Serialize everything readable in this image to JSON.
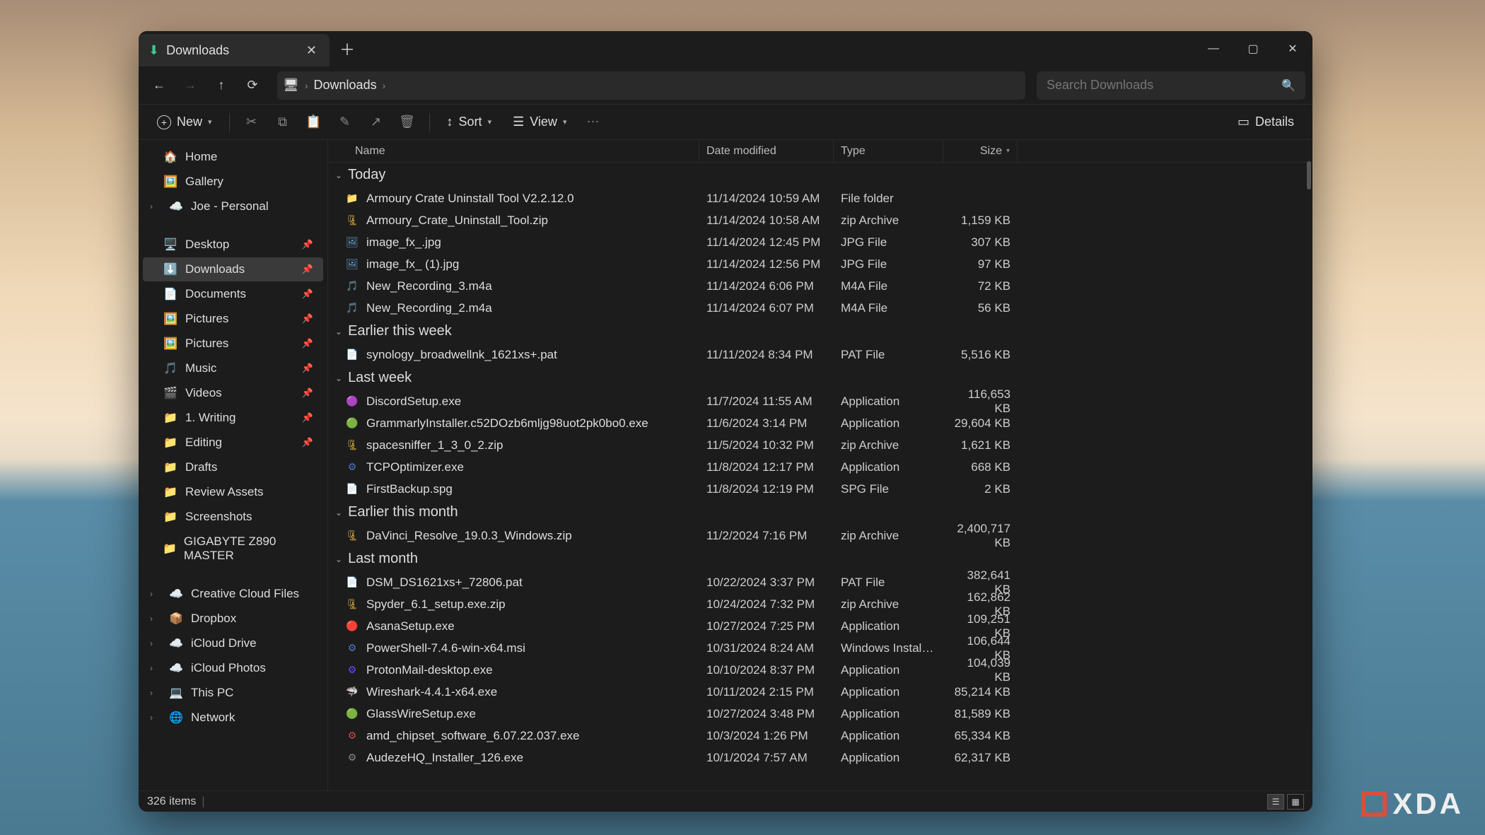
{
  "tab": {
    "title": "Downloads"
  },
  "breadcrumb": {
    "segment": "Downloads"
  },
  "search": {
    "placeholder": "Search Downloads"
  },
  "toolbar": {
    "new": "New",
    "sort": "Sort",
    "view": "View",
    "details": "Details"
  },
  "columns": {
    "name": "Name",
    "date": "Date modified",
    "type": "Type",
    "size": "Size"
  },
  "sidebar": {
    "top": [
      {
        "icon": "🏠",
        "label": "Home"
      },
      {
        "icon": "🖼️",
        "label": "Gallery"
      },
      {
        "icon": "☁️",
        "label": "Joe - Personal",
        "chev": true
      }
    ],
    "pinned": [
      {
        "icon": "🖥️",
        "label": "Desktop",
        "pin": true
      },
      {
        "icon": "⬇️",
        "label": "Downloads",
        "pin": true,
        "active": true
      },
      {
        "icon": "📄",
        "label": "Documents",
        "pin": true
      },
      {
        "icon": "🖼️",
        "label": "Pictures",
        "pin": true
      },
      {
        "icon": "🖼️",
        "label": "Pictures",
        "pin": true
      },
      {
        "icon": "🎵",
        "label": "Music",
        "pin": true
      },
      {
        "icon": "🎬",
        "label": "Videos",
        "pin": true
      },
      {
        "icon": "📁",
        "label": "1. Writing",
        "pin": true
      },
      {
        "icon": "📁",
        "label": "Editing",
        "pin": true
      },
      {
        "icon": "📁",
        "label": "Drafts"
      },
      {
        "icon": "📁",
        "label": "Review Assets"
      },
      {
        "icon": "📁",
        "label": "Screenshots"
      },
      {
        "icon": "📁",
        "label": "GIGABYTE Z890 MASTER"
      }
    ],
    "bottom": [
      {
        "icon": "☁️",
        "label": "Creative Cloud Files",
        "chev": true
      },
      {
        "icon": "📦",
        "label": "Dropbox",
        "chev": true
      },
      {
        "icon": "☁️",
        "label": "iCloud Drive",
        "chev": true
      },
      {
        "icon": "☁️",
        "label": "iCloud Photos",
        "chev": true
      },
      {
        "icon": "💻",
        "label": "This PC",
        "chev": true
      },
      {
        "icon": "🌐",
        "label": "Network",
        "chev": true
      }
    ]
  },
  "groups": [
    {
      "label": "Today",
      "files": [
        {
          "icon": "📁",
          "ic": "#f0c04a",
          "name": "Armoury Crate Uninstall Tool V2.2.12.0",
          "date": "11/14/2024 10:59 AM",
          "type": "File folder",
          "size": ""
        },
        {
          "icon": "🗜",
          "ic": "#f0c04a",
          "name": "Armoury_Crate_Uninstall_Tool.zip",
          "date": "11/14/2024 10:58 AM",
          "type": "zip Archive",
          "size": "1,159 KB"
        },
        {
          "icon": "🖼",
          "ic": "#6aa8d8",
          "name": "image_fx_.jpg",
          "date": "11/14/2024 12:45 PM",
          "type": "JPG File",
          "size": "307 KB"
        },
        {
          "icon": "🖼",
          "ic": "#6aa8d8",
          "name": "image_fx_ (1).jpg",
          "date": "11/14/2024 12:56 PM",
          "type": "JPG File",
          "size": "97 KB"
        },
        {
          "icon": "🎵",
          "ic": "#d85a8a",
          "name": "New_Recording_3.m4a",
          "date": "11/14/2024 6:06 PM",
          "type": "M4A File",
          "size": "72 KB"
        },
        {
          "icon": "🎵",
          "ic": "#d85a8a",
          "name": "New_Recording_2.m4a",
          "date": "11/14/2024 6:07 PM",
          "type": "M4A File",
          "size": "56 KB"
        }
      ]
    },
    {
      "label": "Earlier this week",
      "files": [
        {
          "icon": "📄",
          "ic": "#888",
          "name": "synology_broadwellnk_1621xs+.pat",
          "date": "11/11/2024 8:34 PM",
          "type": "PAT File",
          "size": "5,516 KB"
        }
      ]
    },
    {
      "label": "Last week",
      "files": [
        {
          "icon": "🟣",
          "ic": "#5865f2",
          "name": "DiscordSetup.exe",
          "date": "11/7/2024 11:55 AM",
          "type": "Application",
          "size": "116,653 KB"
        },
        {
          "icon": "🟢",
          "ic": "#15c39a",
          "name": "GrammarlyInstaller.c52DOzb6mljg98uot2pk0bo0.exe",
          "date": "11/6/2024 3:14 PM",
          "type": "Application",
          "size": "29,604 KB"
        },
        {
          "icon": "🗜",
          "ic": "#f0c04a",
          "name": "spacesniffer_1_3_0_2.zip",
          "date": "11/5/2024 10:32 PM",
          "type": "zip Archive",
          "size": "1,621 KB"
        },
        {
          "icon": "⚙",
          "ic": "#4a7ac8",
          "name": "TCPOptimizer.exe",
          "date": "11/8/2024 12:17 PM",
          "type": "Application",
          "size": "668 KB"
        },
        {
          "icon": "📄",
          "ic": "#888",
          "name": "FirstBackup.spg",
          "date": "11/8/2024 12:19 PM",
          "type": "SPG File",
          "size": "2 KB"
        }
      ]
    },
    {
      "label": "Earlier this month",
      "files": [
        {
          "icon": "🗜",
          "ic": "#f0c04a",
          "name": "DaVinci_Resolve_19.0.3_Windows.zip",
          "date": "11/2/2024 7:16 PM",
          "type": "zip Archive",
          "size": "2,400,717 KB"
        }
      ]
    },
    {
      "label": "Last month",
      "files": [
        {
          "icon": "📄",
          "ic": "#888",
          "name": "DSM_DS1621xs+_72806.pat",
          "date": "10/22/2024 3:37 PM",
          "type": "PAT File",
          "size": "382,641 KB"
        },
        {
          "icon": "🗜",
          "ic": "#f0c04a",
          "name": "Spyder_6.1_setup.exe.zip",
          "date": "10/24/2024 7:32 PM",
          "type": "zip Archive",
          "size": "162,862 KB"
        },
        {
          "icon": "🔴",
          "ic": "#f06a6a",
          "name": "AsanaSetup.exe",
          "date": "10/27/2024 7:25 PM",
          "type": "Application",
          "size": "109,251 KB"
        },
        {
          "icon": "⚙",
          "ic": "#4a7ac8",
          "name": "PowerShell-7.4.6-win-x64.msi",
          "date": "10/31/2024 8:24 AM",
          "type": "Windows Installer Pa...",
          "size": "106,644 KB"
        },
        {
          "icon": "⚙",
          "ic": "#6d4aff",
          "name": "ProtonMail-desktop.exe",
          "date": "10/10/2024 8:37 PM",
          "type": "Application",
          "size": "104,039 KB"
        },
        {
          "icon": "🦈",
          "ic": "#4a9ac8",
          "name": "Wireshark-4.4.1-x64.exe",
          "date": "10/11/2024 2:15 PM",
          "type": "Application",
          "size": "85,214 KB"
        },
        {
          "icon": "🟢",
          "ic": "#3ac86a",
          "name": "GlassWireSetup.exe",
          "date": "10/27/2024 3:48 PM",
          "type": "Application",
          "size": "81,589 KB"
        },
        {
          "icon": "⚙",
          "ic": "#c84a4a",
          "name": "amd_chipset_software_6.07.22.037.exe",
          "date": "10/3/2024 1:26 PM",
          "type": "Application",
          "size": "65,334 KB"
        },
        {
          "icon": "⚙",
          "ic": "#888",
          "name": "AudezeHQ_Installer_126.exe",
          "date": "10/1/2024 7:57 AM",
          "type": "Application",
          "size": "62,317 KB"
        }
      ]
    }
  ],
  "status": {
    "count": "326 items"
  }
}
